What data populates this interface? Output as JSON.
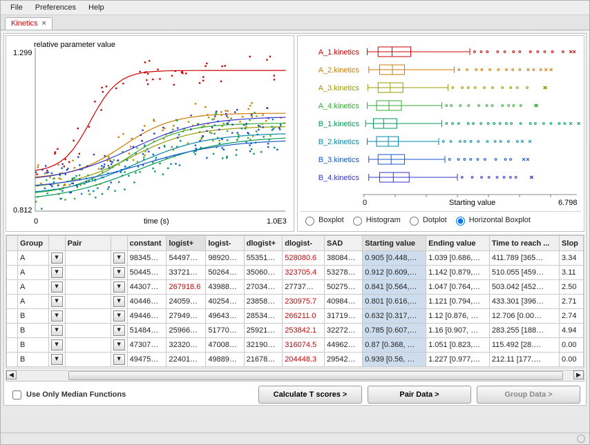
{
  "menu": {
    "file": "File",
    "prefs": "Preferences",
    "help": "Help"
  },
  "tab": {
    "label": "Kinetics",
    "close": "×"
  },
  "scatter": {
    "ylabel_text": "relative parameter value",
    "y_max": "1.299",
    "y_min": "0.812",
    "x_min": "0",
    "xlabel": "time (s)",
    "x_max": "1.0E3"
  },
  "box": {
    "labels": [
      "A_1.kinetics",
      "A_2.kinetics",
      "A_3.kinetics",
      "A_4.kinetics",
      "B_1.kinetics",
      "B_2.kinetics",
      "B_3.kinetics",
      "B_4.kinetics"
    ],
    "colors": [
      "#cc0000",
      "#cc7a00",
      "#999900",
      "#33aa33",
      "#009955",
      "#0088aa",
      "#1155cc",
      "#3333cc"
    ],
    "x_min": "0",
    "xlabel": "Starting value",
    "x_max": "6.798"
  },
  "radios": {
    "boxplot": "Boxplot",
    "histogram": "Histogram",
    "dotplot": "Dotplot",
    "hboxplot": "Horizontal Boxplot"
  },
  "table": {
    "headers": [
      "",
      "Group",
      "",
      "Pair",
      "",
      "constant",
      "logist+",
      "logist-",
      "dlogist+",
      "dlogist-",
      "SAD",
      "Starting value",
      "Ending value",
      "Time to reach ...",
      "Slop"
    ],
    "rows": [
      {
        "g": "A",
        "c": [
          "98345…",
          "54497…",
          "98920…",
          "55351…",
          "528080.6",
          "38084…",
          "0.905 [0.448,…",
          "1.039 [0.686,…",
          "411.789 [365…",
          "3.34"
        ],
        "red": 4
      },
      {
        "g": "A",
        "c": [
          "50445…",
          "33721…",
          "50264…",
          "35060…",
          "323705.4",
          "53278…",
          "0.912 [0.609,…",
          "1.142 [0.879,…",
          "510.055 [459…",
          "3.11"
        ],
        "red": 4
      },
      {
        "g": "A",
        "c": [
          "44307…",
          "267918.6",
          "43988…",
          "27034…",
          "27737…",
          "50275…",
          "0.841 [0.564,…",
          "1.047 [0.764,…",
          "503.042 [452…",
          "2.50"
        ],
        "red": 1
      },
      {
        "g": "A",
        "c": [
          "40446…",
          "24059…",
          "40254…",
          "23858…",
          "230975.7",
          "40984…",
          "0.801 [0.616,…",
          "1.121 [0.794,…",
          "433.301 [396…",
          "2.71"
        ],
        "red": 4
      },
      {
        "g": "B",
        "c": [
          "49446…",
          "27949…",
          "49643…",
          "28534…",
          "266211.0",
          "31719…",
          "0.632 [0.317,…",
          "1.12 [0.876, …",
          "12.706 [0.00…",
          "2.74"
        ],
        "red": 4
      },
      {
        "g": "B",
        "c": [
          "51484…",
          "25966…",
          "51770…",
          "25921…",
          "253842.1",
          "32272…",
          "0.785 [0.607,…",
          "1.16 [0.907, …",
          "283.255 [188…",
          "4.94"
        ],
        "red": 4
      },
      {
        "g": "B",
        "c": [
          "47307…",
          "32320…",
          "47008…",
          "32190…",
          "316074.5",
          "44962…",
          "0.87 [0.368, …",
          "1.051 [0.823,…",
          "115.492 [28.…",
          "0.00"
        ],
        "red": 4
      },
      {
        "g": "B",
        "c": [
          "49475…",
          "22401…",
          "49889…",
          "21678…",
          "204448.3",
          "29542…",
          "0.939 [0.56, …",
          "1.227 [0.977,…",
          "212.11 [177.…",
          "0.00"
        ],
        "red": 4
      }
    ]
  },
  "bottom": {
    "chk": "Use Only Median Functions",
    "calc": "Calculate T scores >",
    "pair": "Pair Data >",
    "group": "Group Data >"
  },
  "chart_data": {
    "scatter": {
      "type": "scatter-with-trend",
      "title": "",
      "xlabel": "time (s)",
      "ylabel": "relative parameter value",
      "xlim": [
        0,
        1000
      ],
      "ylim": [
        0.812,
        1.299
      ],
      "series_note": "8 kinetics series (scatter + sigmoid trend) — exact point values not labeled in source; curves rise from ~0.82-0.95 at t=0 toward ~1.0-1.25 plateau near t=1000, with varying inflection steepness."
    },
    "boxplot": {
      "type": "horizontal-boxplot",
      "xlabel": "Starting value",
      "xlim": [
        0,
        6.798
      ],
      "categories": [
        "A_1.kinetics",
        "A_2.kinetics",
        "A_3.kinetics",
        "A_4.kinetics",
        "B_1.kinetics",
        "B_2.kinetics",
        "B_3.kinetics",
        "B_4.kinetics"
      ],
      "boxes": [
        {
          "min": 0.1,
          "q1": 0.45,
          "med": 0.9,
          "q3": 1.5,
          "max": 3.4,
          "outliers_to": 6.5
        },
        {
          "min": 0.15,
          "q1": 0.5,
          "med": 0.91,
          "q3": 1.3,
          "max": 2.9,
          "outliers_to": 5.8
        },
        {
          "min": 0.12,
          "q1": 0.45,
          "med": 0.84,
          "q3": 1.25,
          "max": 2.7,
          "outliers_to": 5.5
        },
        {
          "min": 0.1,
          "q1": 0.4,
          "med": 0.8,
          "q3": 1.2,
          "max": 2.5,
          "outliers_to": 5.2
        },
        {
          "min": 0.05,
          "q1": 0.3,
          "med": 0.63,
          "q3": 1.05,
          "max": 2.5,
          "outliers_to": 6.6
        },
        {
          "min": 0.1,
          "q1": 0.4,
          "med": 0.78,
          "q3": 1.1,
          "max": 2.4,
          "outliers_to": 5.0
        },
        {
          "min": 0.15,
          "q1": 0.45,
          "med": 0.87,
          "q3": 1.3,
          "max": 2.6,
          "outliers_to": 5.0
        },
        {
          "min": 0.15,
          "q1": 0.5,
          "med": 0.94,
          "q3": 1.45,
          "max": 3.0,
          "outliers_to": 5.0
        }
      ]
    }
  }
}
